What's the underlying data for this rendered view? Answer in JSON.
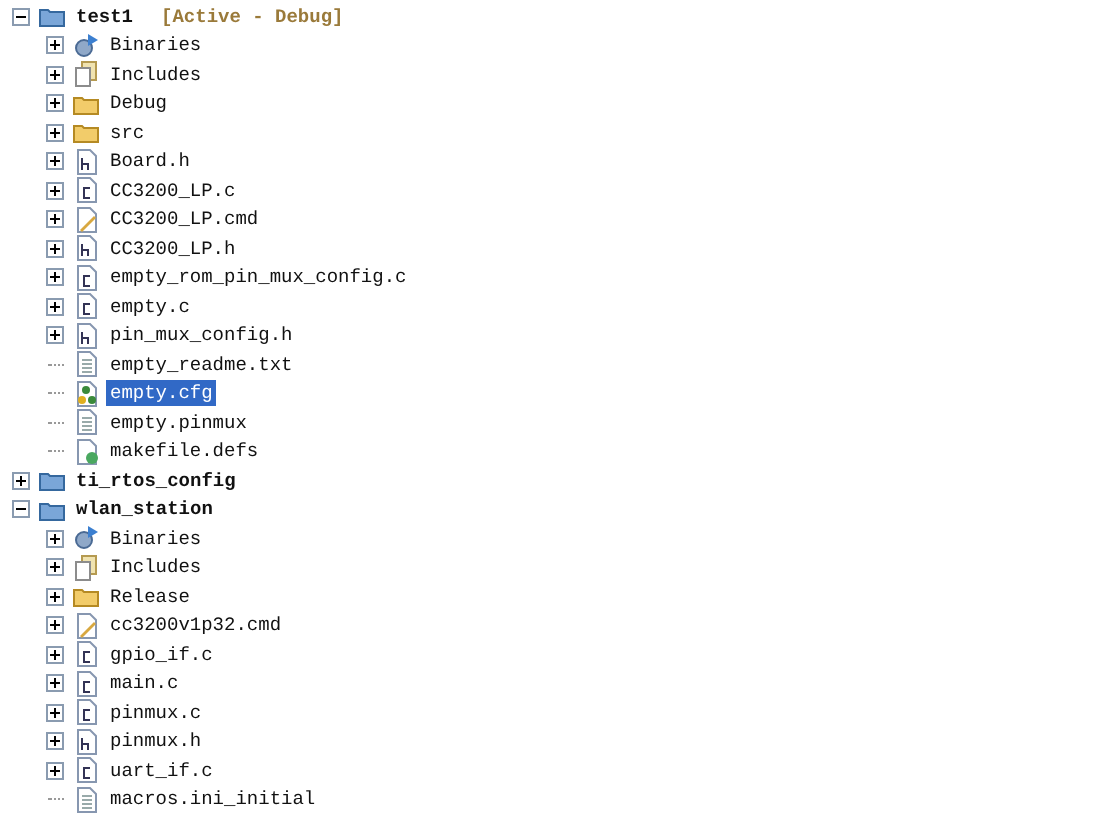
{
  "tree": [
    {
      "label": "test1",
      "annotation": "[Active - Debug]",
      "kind": "project",
      "expanded": true,
      "selected": false,
      "children": [
        {
          "label": "Binaries",
          "kind": "binaries",
          "expanded": false,
          "selected": false
        },
        {
          "label": "Includes",
          "kind": "includes",
          "expanded": false,
          "selected": false
        },
        {
          "label": "Debug",
          "kind": "folder",
          "expanded": false,
          "selected": false
        },
        {
          "label": "src",
          "kind": "folder",
          "expanded": false,
          "selected": false
        },
        {
          "label": "Board.h",
          "kind": "h",
          "expanded": false,
          "selected": false
        },
        {
          "label": "CC3200_LP.c",
          "kind": "c",
          "expanded": false,
          "selected": false
        },
        {
          "label": "CC3200_LP.cmd",
          "kind": "cmd",
          "expanded": false,
          "selected": false
        },
        {
          "label": "CC3200_LP.h",
          "kind": "h",
          "expanded": false,
          "selected": false
        },
        {
          "label": "empty_rom_pin_mux_config.c",
          "kind": "c",
          "expanded": false,
          "selected": false
        },
        {
          "label": "empty.c",
          "kind": "c",
          "expanded": false,
          "selected": false
        },
        {
          "label": "pin_mux_config.h",
          "kind": "h",
          "expanded": false,
          "selected": false
        },
        {
          "label": "empty_readme.txt",
          "kind": "text",
          "selected": false
        },
        {
          "label": "empty.cfg",
          "kind": "cfg",
          "selected": true
        },
        {
          "label": "empty.pinmux",
          "kind": "text",
          "selected": false
        },
        {
          "label": "makefile.defs",
          "kind": "make",
          "selected": false
        }
      ]
    },
    {
      "label": "ti_rtos_config",
      "kind": "project",
      "expanded": false,
      "selected": false
    },
    {
      "label": "wlan_station",
      "kind": "project",
      "expanded": true,
      "selected": false,
      "children": [
        {
          "label": "Binaries",
          "kind": "binaries",
          "expanded": false,
          "selected": false
        },
        {
          "label": "Includes",
          "kind": "includes",
          "expanded": false,
          "selected": false
        },
        {
          "label": "Release",
          "kind": "folder",
          "expanded": false,
          "selected": false
        },
        {
          "label": "cc3200v1p32.cmd",
          "kind": "cmd",
          "expanded": false,
          "selected": false
        },
        {
          "label": "gpio_if.c",
          "kind": "c",
          "expanded": false,
          "selected": false
        },
        {
          "label": "main.c",
          "kind": "c",
          "expanded": false,
          "selected": false
        },
        {
          "label": "pinmux.c",
          "kind": "c",
          "expanded": false,
          "selected": false
        },
        {
          "label": "pinmux.h",
          "kind": "h",
          "expanded": false,
          "selected": false
        },
        {
          "label": "uart_if.c",
          "kind": "c",
          "expanded": false,
          "selected": false
        },
        {
          "label": "macros.ini_initial",
          "kind": "text",
          "selected": false
        }
      ]
    }
  ]
}
